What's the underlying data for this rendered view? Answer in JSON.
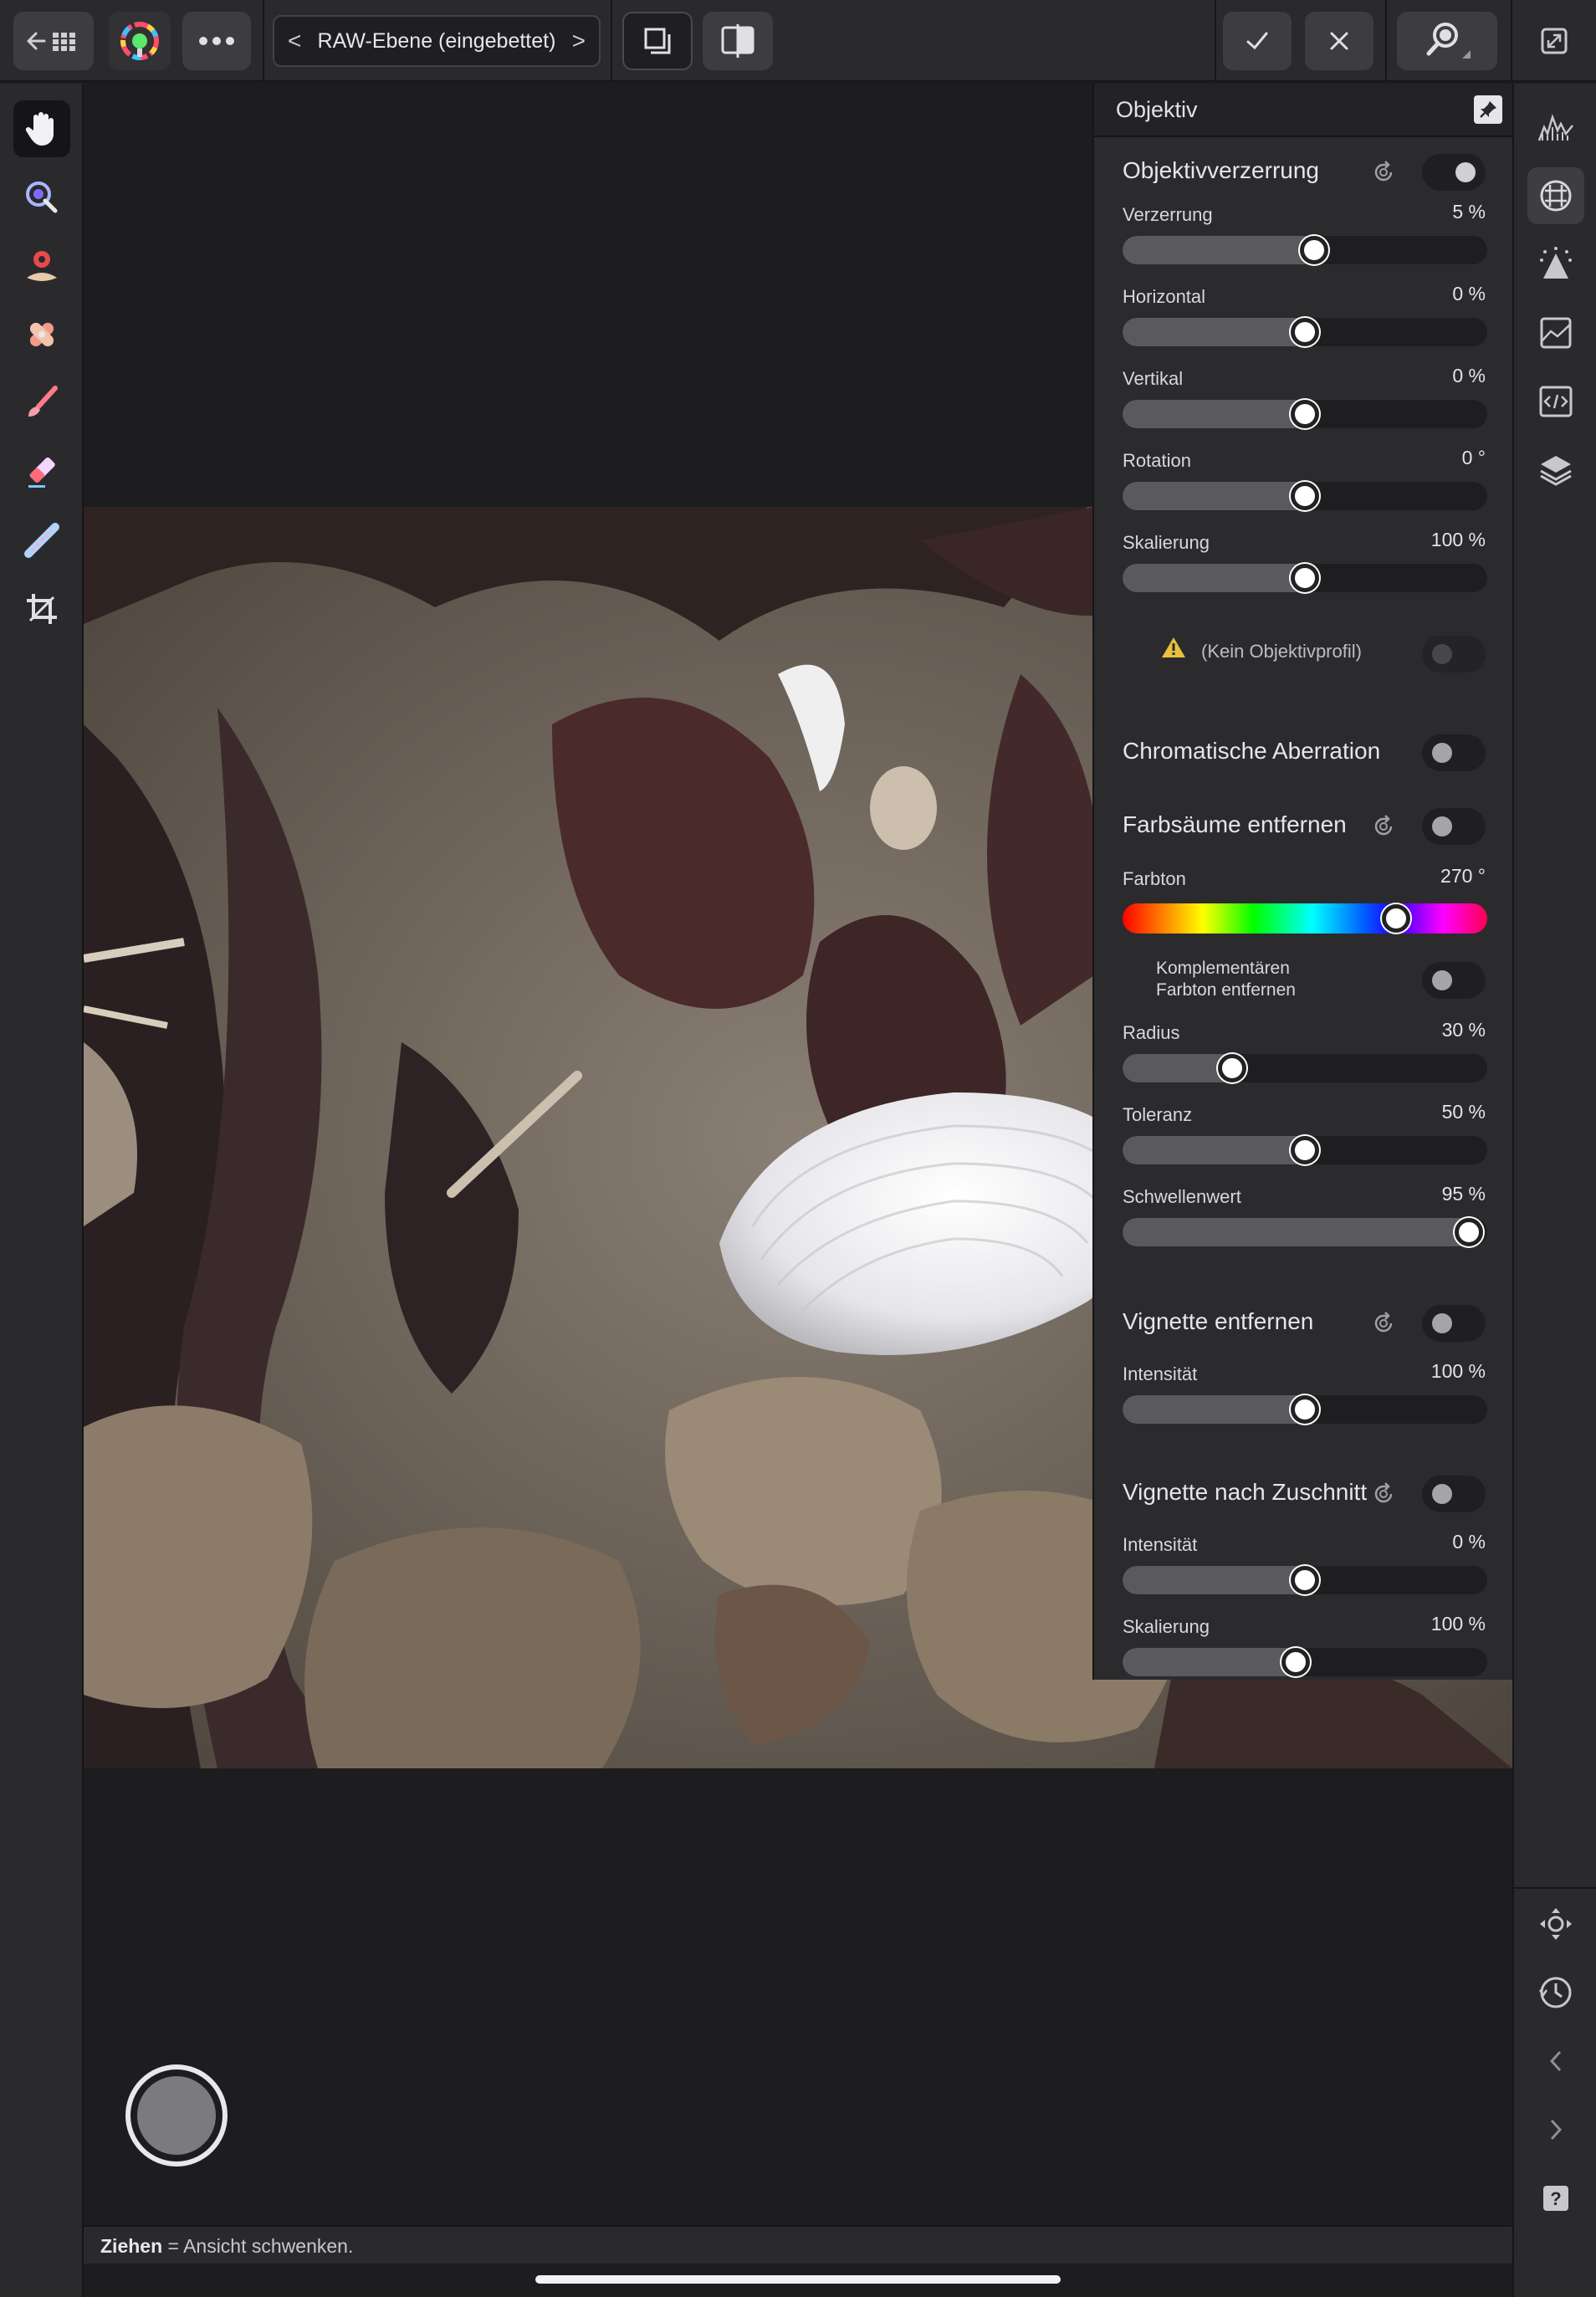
{
  "topbar": {
    "persona_title": "RAW-Ebene (eingebettet)",
    "icons": [
      "back-grid-icon",
      "develop-persona-icon",
      "more-icon",
      "overlay-icon",
      "split-view-icon",
      "commit-icon",
      "cancel-icon",
      "zoom-icon",
      "fullscreen-icon"
    ],
    "prev_arrow": "<",
    "next_arrow": ">"
  },
  "left_tools": [
    "view-tool-hand",
    "white-balance-tool",
    "red-eye-tool",
    "blemish-tool",
    "brush-tool",
    "erase-tool",
    "overlay-gradient-tool",
    "crop-tool"
  ],
  "right_studio": [
    "histogram-icon",
    "lens-icon",
    "details-icon",
    "tones-icon",
    "scope-icon",
    "layers-icon",
    "move-icon",
    "history-icon",
    "chevron-left-icon",
    "chevron-right-icon",
    "help-icon"
  ],
  "panel": {
    "title": "Objektiv",
    "lens_distortion": {
      "title": "Objektivverzerrung",
      "enabled": true,
      "sliders": [
        {
          "label": "Verzerrung",
          "value": "5 %",
          "pos": 0.525
        },
        {
          "label": "Horizontal",
          "value": "0 %",
          "pos": 0.5
        },
        {
          "label": "Vertikal",
          "value": "0 %",
          "pos": 0.5
        },
        {
          "label": "Rotation",
          "value": "0 °",
          "pos": 0.5
        },
        {
          "label": "Skalierung",
          "value": "100 %",
          "pos": 0.5
        }
      ],
      "profile_warning": "(Kein Objektivprofil)"
    },
    "chromatic": {
      "title": "Chromatische Aberration",
      "enabled": false
    },
    "defringe": {
      "title": "Farbsäume entfernen",
      "enabled": false,
      "hue_label": "Farbton",
      "hue_value": "270 °",
      "hue_pos": 0.75,
      "complement_label_1": "Komplementären",
      "complement_label_2": "Farbton entfernen",
      "sliders": [
        {
          "label": "Radius",
          "value": "30 %",
          "pos": 0.3
        },
        {
          "label": "Toleranz",
          "value": "50 %",
          "pos": 0.5
        },
        {
          "label": "Schwellenwert",
          "value": "95 %",
          "pos": 0.95
        }
      ]
    },
    "vignette": {
      "title": "Vignette entfernen",
      "enabled": false,
      "sliders": [
        {
          "label": "Intensität",
          "value": "100 %",
          "pos": 0.5
        }
      ]
    },
    "post_crop": {
      "title": "Vignette nach Zuschnitt",
      "enabled": false,
      "sliders": [
        {
          "label": "Intensität",
          "value": "0 %",
          "pos": 0.5
        },
        {
          "label": "Skalierung",
          "value": "100 %",
          "pos": 0.475
        }
      ]
    }
  },
  "status": {
    "bold": "Ziehen",
    "rest": " = Ansicht schwenken."
  },
  "colors": {
    "accent": "#2a2a2c",
    "panel": "#2b2b2d",
    "track": "#1e1e20"
  }
}
